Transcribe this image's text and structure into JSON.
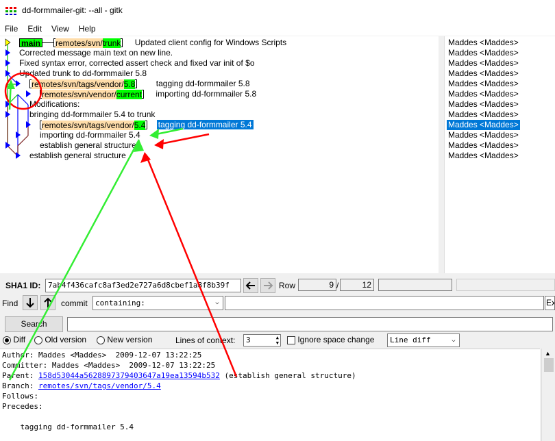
{
  "window": {
    "title": "dd-formmailer-git: --all - gitk"
  },
  "menu": [
    "File",
    "Edit",
    "View",
    "Help"
  ],
  "commits": [
    {
      "tags": [
        {
          "kind": "local",
          "name": "main"
        },
        {
          "kind": "remote",
          "prefix": "remotes/svn/",
          "branch": "trunk"
        }
      ],
      "message": "Updated client config for Windows Scripts",
      "author": "Maddes <Maddes>"
    },
    {
      "tags": [],
      "message": "Corrected message main text on new line.",
      "author": "Maddes <Maddes>"
    },
    {
      "tags": [],
      "message": "Fixed syntax error, corrected assert check and fixed var init of $o",
      "author": "Maddes <Maddes>"
    },
    {
      "tags": [],
      "message": "Updated trunk to dd-formmailer 5.8",
      "author": "Maddes <Maddes>"
    },
    {
      "tags": [
        {
          "kind": "remote",
          "prefix": "remotes/svn/tags/vendor/",
          "branch": "5.8"
        }
      ],
      "message": "tagging dd-formmailer 5.8",
      "author": "Maddes <Maddes>"
    },
    {
      "tags": [
        {
          "kind": "remote",
          "prefix": "remotes/svn/vendor/",
          "branch": "current"
        }
      ],
      "message": "importing dd-formmailer 5.8",
      "author": "Maddes <Maddes>"
    },
    {
      "tags": [],
      "message": "Modifications:",
      "author": "Maddes <Maddes>"
    },
    {
      "tags": [],
      "message": "bringing dd-formmailer 5.4 to trunk",
      "author": "Maddes <Maddes>"
    },
    {
      "tags": [
        {
          "kind": "remote",
          "prefix": "remotes/svn/tags/vendor/",
          "branch": "5.4"
        }
      ],
      "message": "tagging dd-formmailer 5.4",
      "author": "Maddes <Maddes>",
      "selected": true
    },
    {
      "tags": [],
      "message": "importing dd-formmailer 5.4",
      "author": "Maddes <Maddes>"
    },
    {
      "tags": [],
      "message": "establish general structure",
      "author": "Maddes <Maddes>"
    },
    {
      "tags": [],
      "message": "establish general structure",
      "author": "Maddes <Maddes>"
    }
  ],
  "sha": {
    "label": "SHA1 ID:",
    "value": "7ab4f436cafc8af3ed2e727a6d8cbef1a8f8b39f",
    "row_label": "Row",
    "row_current": "9",
    "row_sep": "/",
    "row_total": "12"
  },
  "find": {
    "label": "Find",
    "type": "commit",
    "mode": "containing:",
    "value": "",
    "extra": "Ex"
  },
  "search": {
    "button": "Search",
    "value": ""
  },
  "diff_options": {
    "diff": "Diff",
    "old_version": "Old version",
    "new_version": "New version",
    "context_label": "Lines of context:",
    "context_value": "3",
    "ignore_space": "Ignore space change",
    "diff_mode": "Line diff"
  },
  "details": {
    "author": "Author: Maddes <Maddes>  2009-12-07 13:22:25",
    "committer": "Committer: Maddes <Maddes>  2009-12-07 13:22:25",
    "parent_label": "Parent: ",
    "parent_sha": "158d53044a5628897379403647a19ea13594b532",
    "parent_desc": " (establish general structure)",
    "branch_label": "Branch: ",
    "branch_link": "remotes/svn/tags/vendor/5.4",
    "follows": "Follows:",
    "precedes": "Precedes:",
    "message": "    tagging dd-formmailer 5.4"
  },
  "colors": {
    "selection": "#0078d7",
    "local_branch": "#00ff00",
    "remote_prefix": "#ffddaa",
    "link": "#0000ff",
    "annotation_red": "#ff0000",
    "annotation_green": "#00dd00"
  }
}
